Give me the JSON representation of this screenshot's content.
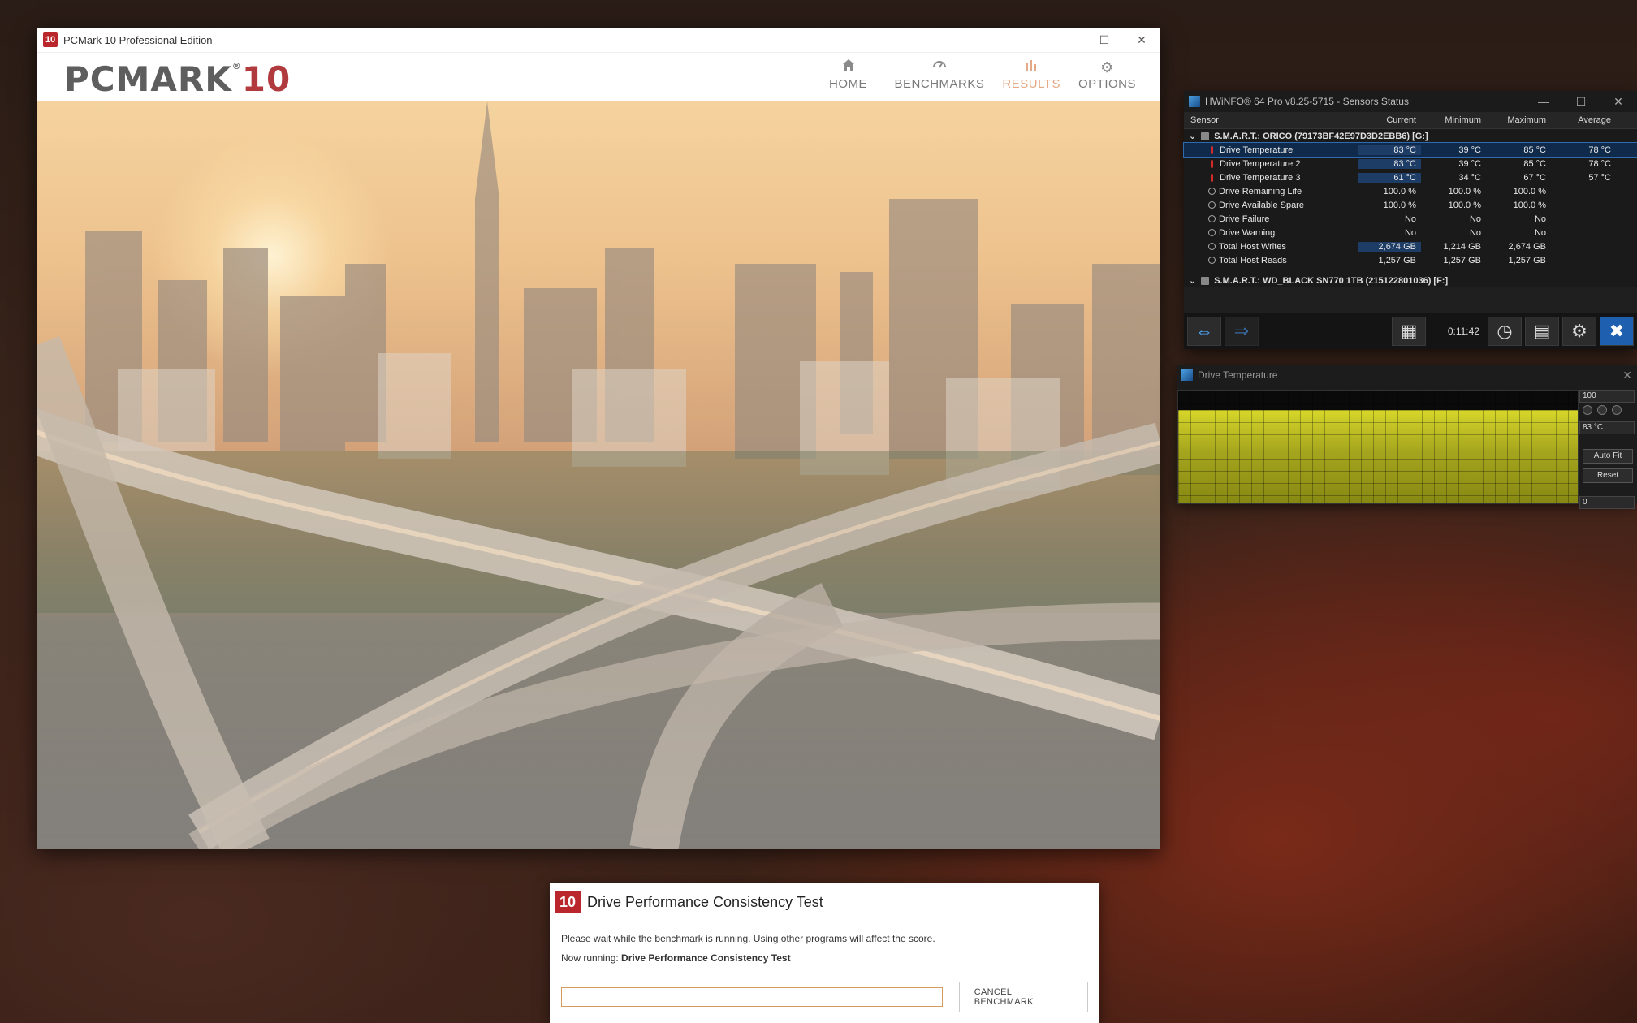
{
  "pcmark": {
    "title": "PCMark 10 Professional Edition",
    "app_icon": "10",
    "logo_main": "PCMARK",
    "logo_num": "10",
    "logo_reg": "®",
    "nav": [
      {
        "label": "HOME",
        "icon": "home-icon"
      },
      {
        "label": "BENCHMARKS",
        "icon": "gauge-icon"
      },
      {
        "label": "RESULTS",
        "icon": "bar-chart-icon",
        "active": true
      },
      {
        "label": "OPTIONS",
        "icon": "gear-icon"
      }
    ]
  },
  "bench": {
    "logo": "10",
    "title": "Drive Performance Consistency Test",
    "message": "Please wait while the benchmark is running. Using other programs will affect the score.",
    "running_prefix": "Now running: ",
    "running_name": "Drive Performance Consistency Test",
    "cancel_label": "CANCEL BENCHMARK",
    "progress": 0
  },
  "hwinfo": {
    "title": "HWiNFO® 64 Pro v8.25-5715 - Sensors Status",
    "columns": [
      "Sensor",
      "Current",
      "Minimum",
      "Maximum",
      "Average"
    ],
    "group1": "S.M.A.R.T.: ORICO (79173BF42E97D3D2EBB6) [G:]",
    "rows": [
      {
        "name": "Drive Temperature",
        "cur": "83 °C",
        "min": "39 °C",
        "max": "85 °C",
        "avg": "78 °C",
        "kind": "temp"
      },
      {
        "name": "Drive Temperature 2",
        "cur": "83 °C",
        "min": "39 °C",
        "max": "85 °C",
        "avg": "78 °C",
        "kind": "temp"
      },
      {
        "name": "Drive Temperature 3",
        "cur": "61 °C",
        "min": "34 °C",
        "max": "67 °C",
        "avg": "57 °C",
        "kind": "temp"
      },
      {
        "name": "Drive Remaining Life",
        "cur": "100.0 %",
        "min": "100.0 %",
        "max": "100.0 %",
        "avg": "",
        "kind": "other"
      },
      {
        "name": "Drive Available Spare",
        "cur": "100.0 %",
        "min": "100.0 %",
        "max": "100.0 %",
        "avg": "",
        "kind": "other"
      },
      {
        "name": "Drive Failure",
        "cur": "No",
        "min": "No",
        "max": "No",
        "avg": "",
        "kind": "other"
      },
      {
        "name": "Drive Warning",
        "cur": "No",
        "min": "No",
        "max": "No",
        "avg": "",
        "kind": "other"
      },
      {
        "name": "Total Host Writes",
        "cur": "2,674 GB",
        "min": "1,214 GB",
        "max": "2,674 GB",
        "avg": "",
        "kind": "other"
      },
      {
        "name": "Total Host Reads",
        "cur": "1,257 GB",
        "min": "1,257 GB",
        "max": "1,257 GB",
        "avg": "",
        "kind": "other"
      }
    ],
    "group2": "S.M.A.R.T.: WD_BLACK SN770 1TB (215122801036) [F:]",
    "time": "0:11:42"
  },
  "graph": {
    "title": "Drive Temperature",
    "max_label": "100",
    "current_label": "83 °C",
    "min_label": "0",
    "autofit_label": "Auto Fit",
    "reset_label": "Reset",
    "level": 0.83
  }
}
